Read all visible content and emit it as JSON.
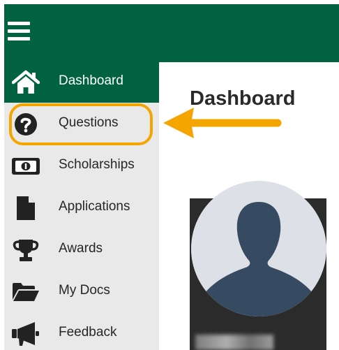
{
  "topbar": {
    "menu_icon": "hamburger-menu-icon",
    "color": "#006241"
  },
  "sidebar": {
    "items": [
      {
        "label": "Dashboard",
        "icon": "home-icon",
        "active": true
      },
      {
        "label": "Questions",
        "icon": "question-circle-icon",
        "active": false,
        "highlighted": true
      },
      {
        "label": "Scholarships",
        "icon": "money-bill-icon",
        "active": false
      },
      {
        "label": "Applications",
        "icon": "file-icon",
        "active": false
      },
      {
        "label": "Awards",
        "icon": "trophy-icon",
        "active": false
      },
      {
        "label": "My Docs",
        "icon": "folder-open-icon",
        "active": false
      },
      {
        "label": "Feedback",
        "icon": "megaphone-icon",
        "active": false
      }
    ]
  },
  "main": {
    "title": "Dashboard",
    "profile": {
      "avatar_icon": "default-avatar-icon"
    }
  },
  "annotation": {
    "color": "#f5a500",
    "arrow_icon": "left-arrow-icon"
  }
}
